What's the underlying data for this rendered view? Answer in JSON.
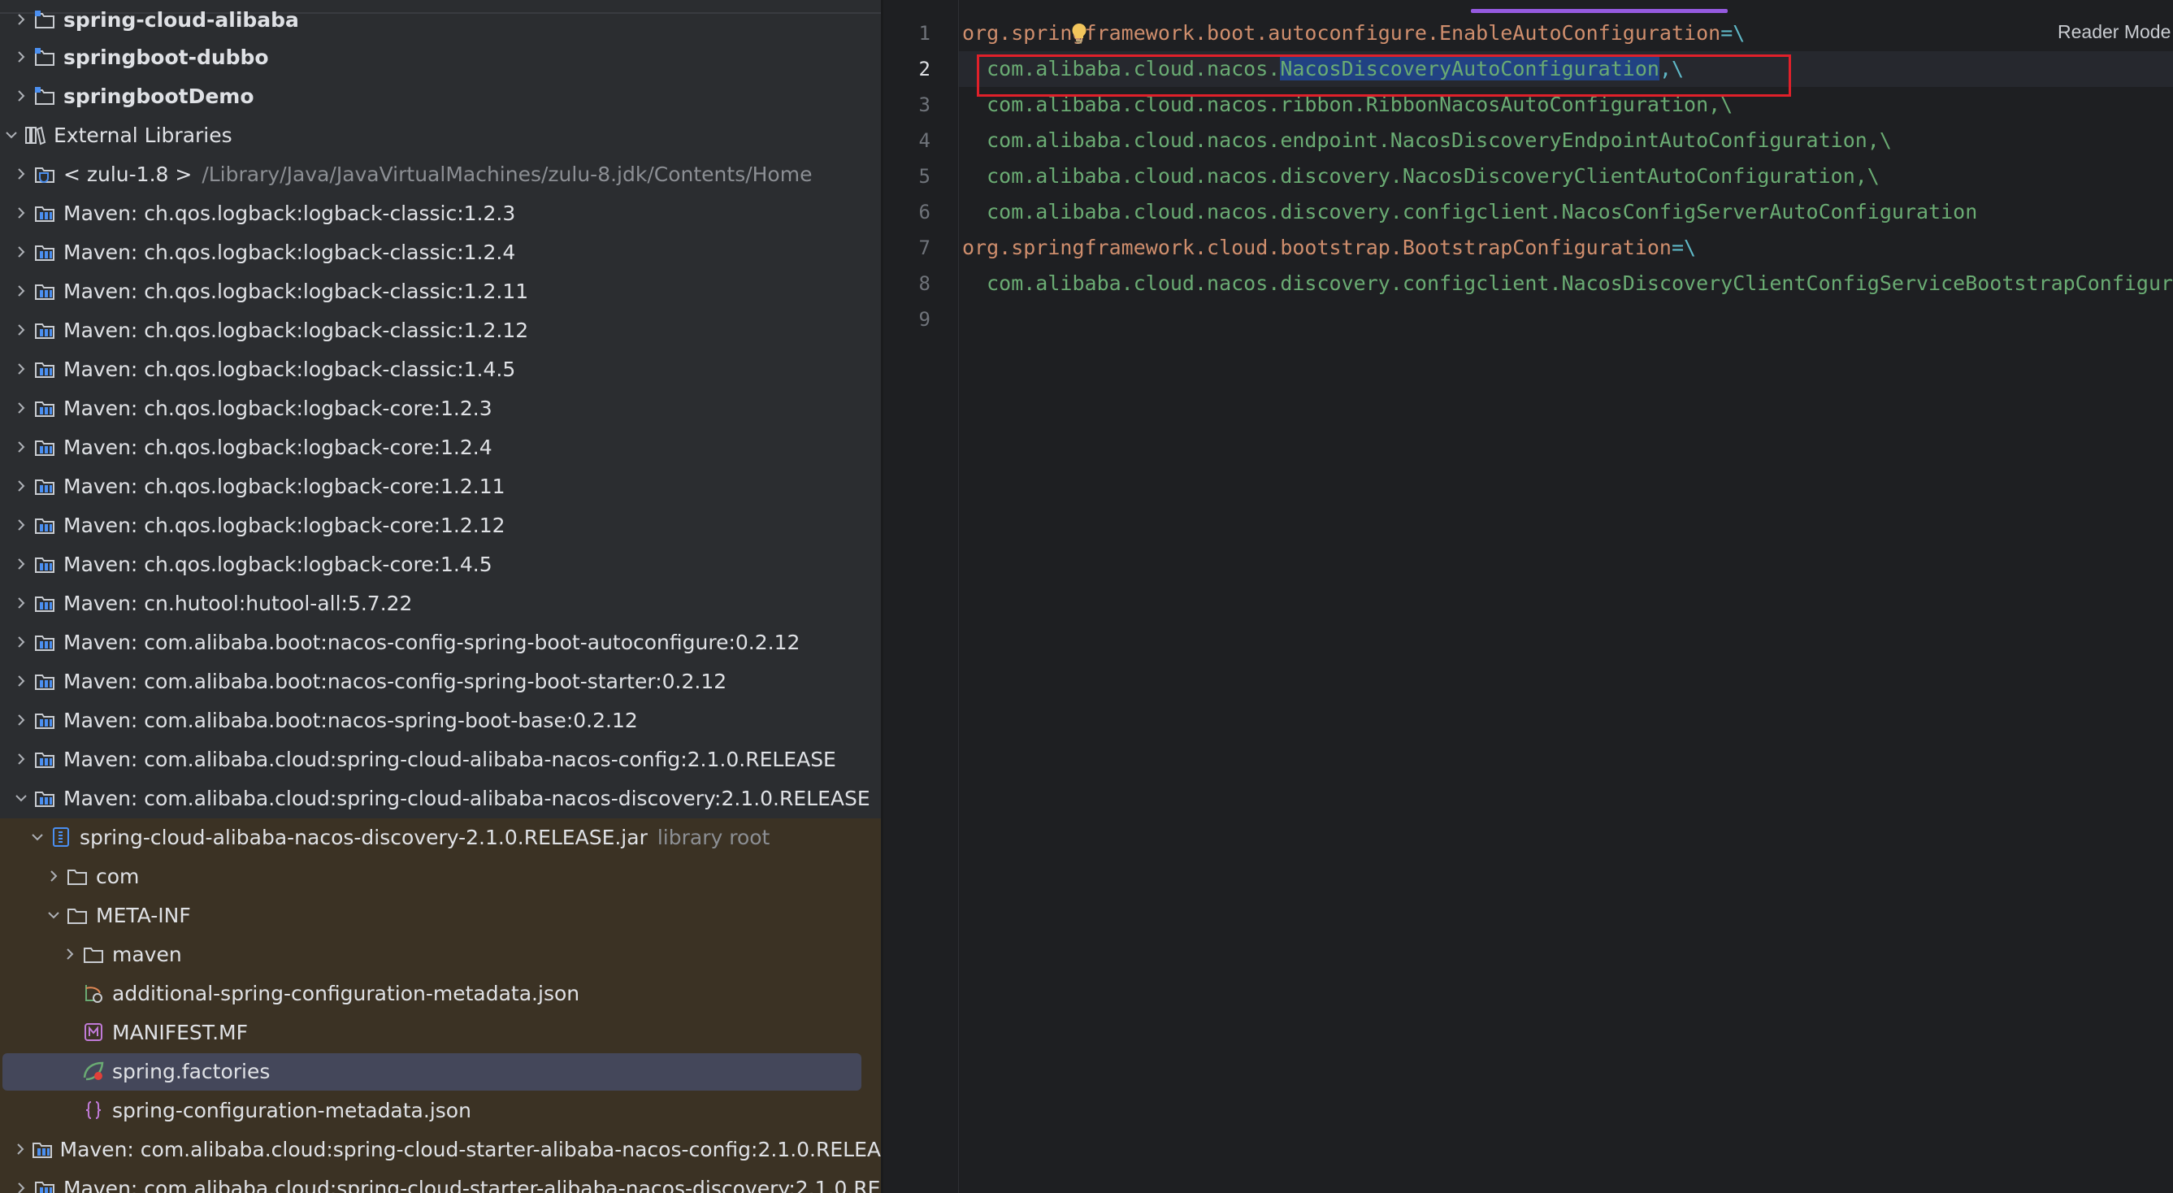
{
  "project_tree": {
    "rows": [
      {
        "label": "spring-cloud-alibaba",
        "kind": "module",
        "bold": true
      },
      {
        "label": "springboot-dubbo",
        "kind": "module",
        "bold": true
      },
      {
        "label": "springbootDemo",
        "kind": "module",
        "bold": true
      },
      {
        "label": "External Libraries",
        "kind": "libraries",
        "expanded": true
      },
      {
        "label": "< zulu-1.8 >",
        "suffix": "/Library/Java/JavaVirtualMachines/zulu-8.jdk/Contents/Home",
        "kind": "jdk"
      },
      {
        "label": "Maven: ch.qos.logback:logback-classic:1.2.3",
        "kind": "maven"
      },
      {
        "label": "Maven: ch.qos.logback:logback-classic:1.2.4",
        "kind": "maven"
      },
      {
        "label": "Maven: ch.qos.logback:logback-classic:1.2.11",
        "kind": "maven"
      },
      {
        "label": "Maven: ch.qos.logback:logback-classic:1.2.12",
        "kind": "maven"
      },
      {
        "label": "Maven: ch.qos.logback:logback-classic:1.4.5",
        "kind": "maven"
      },
      {
        "label": "Maven: ch.qos.logback:logback-core:1.2.3",
        "kind": "maven"
      },
      {
        "label": "Maven: ch.qos.logback:logback-core:1.2.4",
        "kind": "maven"
      },
      {
        "label": "Maven: ch.qos.logback:logback-core:1.2.11",
        "kind": "maven"
      },
      {
        "label": "Maven: ch.qos.logback:logback-core:1.2.12",
        "kind": "maven"
      },
      {
        "label": "Maven: ch.qos.logback:logback-core:1.4.5",
        "kind": "maven"
      },
      {
        "label": "Maven: cn.hutool:hutool-all:5.7.22",
        "kind": "maven"
      },
      {
        "label": "Maven: com.alibaba.boot:nacos-config-spring-boot-autoconfigure:0.2.12",
        "kind": "maven"
      },
      {
        "label": "Maven: com.alibaba.boot:nacos-config-spring-boot-starter:0.2.12",
        "kind": "maven"
      },
      {
        "label": "Maven: com.alibaba.boot:nacos-spring-boot-base:0.2.12",
        "kind": "maven"
      },
      {
        "label": "Maven: com.alibaba.cloud:spring-cloud-alibaba-nacos-config:2.1.0.RELEASE",
        "kind": "maven"
      },
      {
        "label": "Maven: com.alibaba.cloud:spring-cloud-alibaba-nacos-discovery:2.1.0.RELEASE",
        "kind": "maven",
        "expanded": true
      },
      {
        "label": "spring-cloud-alibaba-nacos-discovery-2.1.0.RELEASE.jar",
        "suffix": "library root",
        "kind": "jar",
        "expanded": true
      },
      {
        "label": "com",
        "kind": "folder"
      },
      {
        "label": "META-INF",
        "kind": "folder",
        "expanded": true
      },
      {
        "label": "maven",
        "kind": "folder"
      },
      {
        "label": "additional-spring-configuration-metadata.json",
        "kind": "spring-json"
      },
      {
        "label": "MANIFEST.MF",
        "kind": "manifest"
      },
      {
        "label": "spring.factories",
        "kind": "spring-factories",
        "selected": true
      },
      {
        "label": "spring-configuration-metadata.json",
        "kind": "json"
      },
      {
        "label": "Maven: com.alibaba.cloud:spring-cloud-starter-alibaba-nacos-config:2.1.0.RELEA",
        "kind": "maven"
      },
      {
        "label": "Maven: com.alibaba.cloud:spring-cloud-starter-alibaba-nacos-discovery:2.1.0.RE",
        "kind": "maven"
      }
    ]
  },
  "editor": {
    "reader_mode_label": "Reader Mode",
    "current_line": 2,
    "line_numbers": [
      "1",
      "2",
      "3",
      "4",
      "5",
      "6",
      "7",
      "8",
      "9"
    ],
    "lines": [
      {
        "key": "org.springframework.boot.autoconfigure.EnableAutoConfiguration",
        "op": "=\\"
      },
      {
        "value": "  com.alibaba.cloud.nacos.",
        "selected": "NacosDiscoveryAutoConfiguration",
        "tail": ",\\"
      },
      {
        "value": "  com.alibaba.cloud.nacos.ribbon.RibbonNacosAutoConfiguration,\\"
      },
      {
        "value": "  com.alibaba.cloud.nacos.endpoint.NacosDiscoveryEndpointAutoConfiguration,\\"
      },
      {
        "value": "  com.alibaba.cloud.nacos.discovery.NacosDiscoveryClientAutoConfiguration,\\"
      },
      {
        "value": "  com.alibaba.cloud.nacos.discovery.configclient.NacosConfigServerAutoConfiguration"
      },
      {
        "key": "org.springframework.cloud.bootstrap.BootstrapConfiguration",
        "op": "=\\"
      },
      {
        "value": "  com.alibaba.cloud.nacos.discovery.configclient.NacosDiscoveryClientConfigServiceBootstrapConfiguration"
      },
      {
        "value": ""
      }
    ]
  },
  "colors": {
    "key": "#cf8e6d",
    "value": "#6aab73",
    "operator": "#5fb8c7",
    "selection": "#214283",
    "annotation_box": "#e0202a"
  }
}
